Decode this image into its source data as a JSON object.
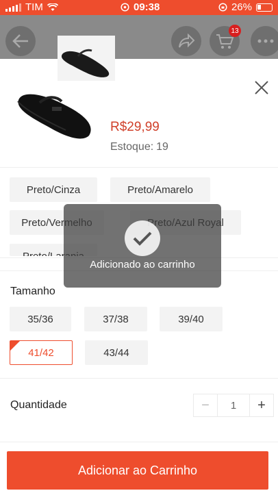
{
  "status_bar": {
    "carrier": "TIM",
    "time": "09:38",
    "battery": "26%"
  },
  "header": {
    "cart_count": "13"
  },
  "product": {
    "price": "R$29,99",
    "stock_label": "Estoque:",
    "stock_value": "19"
  },
  "colors": {
    "options": [
      "Preto/Cinza",
      "Preto/Amarelo",
      "Preto/Vermelho",
      "Preto/Azul Royal",
      "Preto/Laranja"
    ]
  },
  "size": {
    "label": "Tamanho",
    "options": [
      "35/36",
      "37/38",
      "39/40",
      "41/42",
      "43/44"
    ],
    "selected": "41/42"
  },
  "quantity": {
    "label": "Quantidade",
    "value": "1",
    "minus": "−",
    "plus": "+"
  },
  "toast": {
    "message": "Adicionado ao carrinho"
  },
  "cta": {
    "label": "Adicionar ao Carrinho"
  },
  "theme": {
    "accent": "#ee4d2d"
  }
}
